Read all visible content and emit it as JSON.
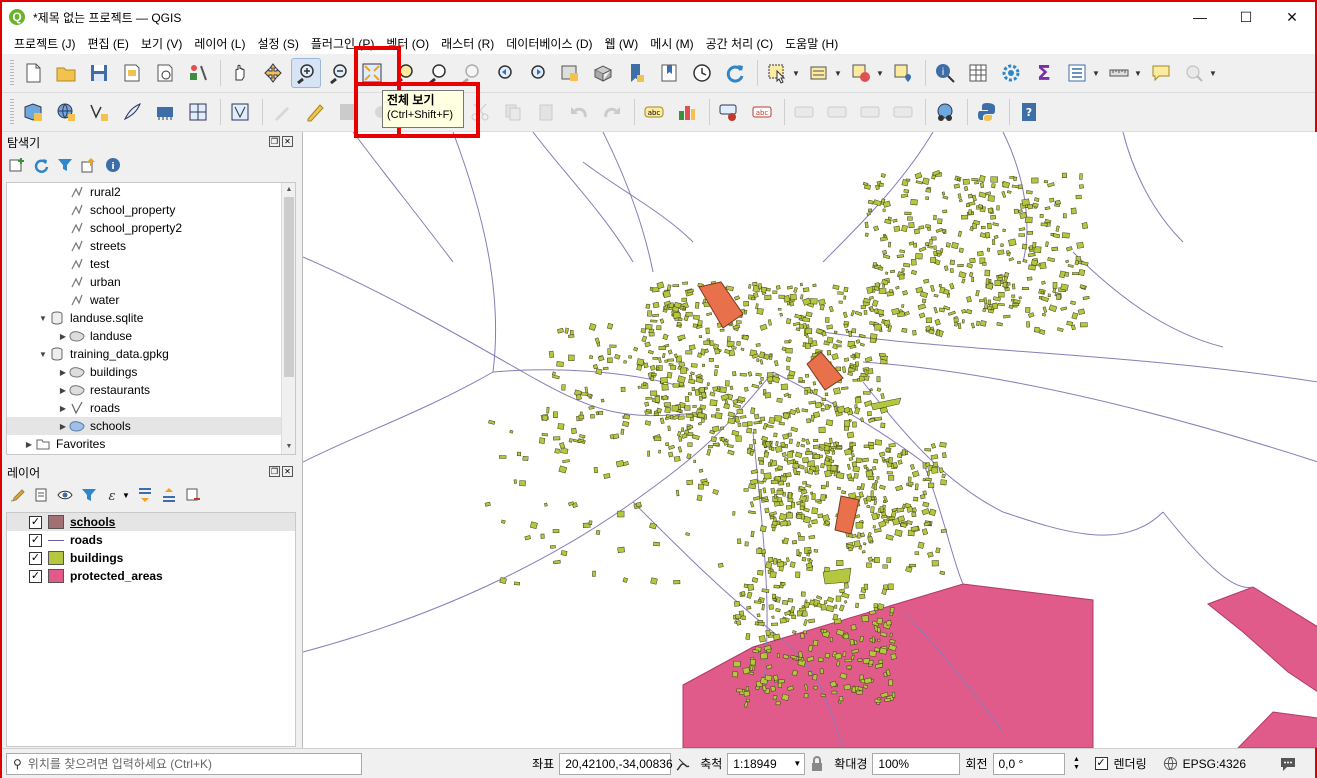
{
  "window": {
    "title": "*제목 없는 프로젝트 — QGIS",
    "logo_letter": "Q",
    "controls": {
      "minimize": "—",
      "maximize": "☐",
      "close": "✕"
    }
  },
  "menu": [
    "프로젝트 (J)",
    "편집 (E)",
    "보기 (V)",
    "레이어 (L)",
    "설정 (S)",
    "플러그인 (P)",
    "벡터 (O)",
    "래스터 (R)",
    "데이터베이스 (D)",
    "웹 (W)",
    "메시 (M)",
    "공간 처리 (C)",
    "도움말 (H)"
  ],
  "tooltip": {
    "title": "전체 보기",
    "shortcut": "(Ctrl+Shift+F)"
  },
  "browser_panel": {
    "title": "탐색기",
    "items": [
      {
        "label": "rural2",
        "level": 3,
        "icon": "vector-line-icon"
      },
      {
        "label": "school_property",
        "level": 3,
        "icon": "vector-line-icon"
      },
      {
        "label": "school_property2",
        "level": 3,
        "icon": "vector-line-icon"
      },
      {
        "label": "streets",
        "level": 3,
        "icon": "vector-line-icon"
      },
      {
        "label": "test",
        "level": 3,
        "icon": "vector-line-icon"
      },
      {
        "label": "urban",
        "level": 3,
        "icon": "vector-line-icon"
      },
      {
        "label": "water",
        "level": 3,
        "icon": "vector-line-icon"
      },
      {
        "label": "landuse.sqlite",
        "level": 2,
        "icon": "database-icon",
        "expanded": true
      },
      {
        "label": "landuse",
        "level": 3,
        "icon": "polygon-layer-icon",
        "collapsed": true
      },
      {
        "label": "training_data.gpkg",
        "level": 2,
        "icon": "database-icon",
        "expanded": true
      },
      {
        "label": "buildings",
        "level": 3,
        "icon": "polygon-layer-icon",
        "collapsed": true
      },
      {
        "label": "restaurants",
        "level": 3,
        "icon": "polygon-layer-icon",
        "collapsed": true
      },
      {
        "label": "roads",
        "level": 3,
        "icon": "line-layer-icon",
        "collapsed": true
      },
      {
        "label": "schools",
        "level": 3,
        "icon": "polygon-layer-icon",
        "collapsed": true,
        "selected": true
      },
      {
        "label": "Favorites",
        "level": 1,
        "icon": "folder-icon",
        "collapsed": true
      }
    ]
  },
  "layers_panel": {
    "title": "레이어",
    "layers": [
      {
        "name": "schools",
        "checked": true,
        "color": "#a26f73",
        "type": "polygon",
        "selected": true
      },
      {
        "name": "roads",
        "checked": true,
        "color": "#6c5fa6",
        "type": "line"
      },
      {
        "name": "buildings",
        "checked": true,
        "color": "#b5c63f",
        "type": "polygon"
      },
      {
        "name": "protected_areas",
        "checked": true,
        "color": "#e05a8a",
        "type": "polygon"
      }
    ]
  },
  "status_bar": {
    "locator_placeholder": "위치를 찾으려면 입력하세요 (Ctrl+K)",
    "coord_label": "좌표",
    "coord_value": "20,42100,-34,00836",
    "scale_label": "축척",
    "scale_value": "1:18949",
    "magnifier_label": "확대경",
    "magnifier_value": "100%",
    "rotation_label": "회전",
    "rotation_value": "0,0 °",
    "render_label": "렌더링",
    "render_checked": true,
    "crs": "EPSG:4326"
  },
  "colors": {
    "schools": "#e8704a",
    "buildings": "#b5c63f",
    "roads": "#8a7bb8",
    "protected_areas": "#e05a8a",
    "highlight": "#e80000"
  }
}
